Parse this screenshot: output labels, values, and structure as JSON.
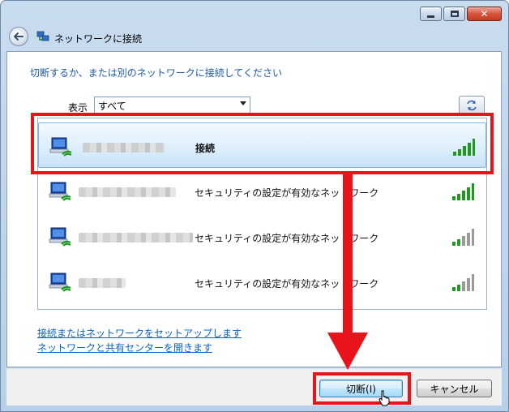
{
  "window": {
    "title": "ネットワークに接続",
    "buttons": {
      "minimize": "minimize-icon",
      "maximize": "maximize-icon",
      "close": "close-icon"
    }
  },
  "instruction": "切断するか、または別のネットワークに接続してください",
  "filter": {
    "label": "表示",
    "selected": "すべて"
  },
  "networks": [
    {
      "status": "接続",
      "signal_bars": 5,
      "selected": true
    },
    {
      "status": "セキュリティの設定が有効なネットワーク",
      "signal_bars": 5,
      "selected": false
    },
    {
      "status": "セキュリティの設定が有効なネットワーク",
      "signal_bars": 3,
      "selected": false
    },
    {
      "status": "セキュリティの設定が有効なネットワーク",
      "signal_bars": 3,
      "selected": false
    }
  ],
  "links": {
    "setup": "接続またはネットワークをセットアップします",
    "center": "ネットワークと共有センターを開きます"
  },
  "footer": {
    "disconnect": "切断(I)",
    "cancel": "キャンセル"
  },
  "colors": {
    "highlight": "#e8131b",
    "signal_active": "#1f9a1f",
    "signal_inactive": "#9a9a9a",
    "link": "#0b62c4"
  }
}
